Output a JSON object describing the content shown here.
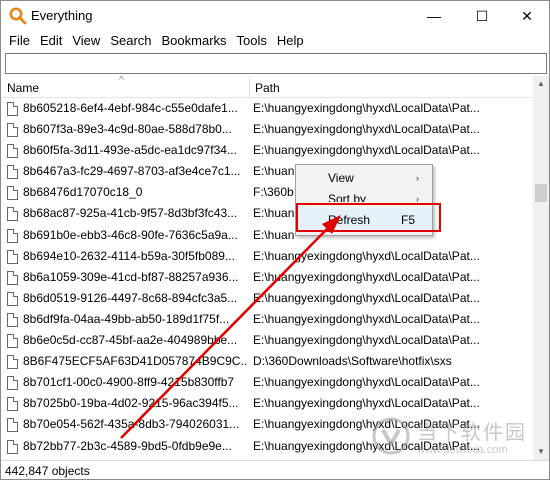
{
  "window": {
    "title": "Everything",
    "minimize_glyph": "—",
    "maximize_glyph": "☐",
    "close_glyph": "✕"
  },
  "menubar": {
    "items": [
      "File",
      "Edit",
      "View",
      "Search",
      "Bookmarks",
      "Tools",
      "Help"
    ]
  },
  "search": {
    "value": "",
    "placeholder": ""
  },
  "columns": {
    "name": "Name",
    "path": "Path",
    "sort_glyph": "^"
  },
  "rows": [
    {
      "name": "8b605218-6ef4-4ebf-984c-c55e0dafe1...",
      "path": "E:\\huangyexingdong\\hyxd\\LocalData\\Pat..."
    },
    {
      "name": "8b607f3a-89e3-4c9d-80ae-588d78b0...",
      "path": "E:\\huangyexingdong\\hyxd\\LocalData\\Pat..."
    },
    {
      "name": "8b60f5fa-3d11-493e-a5dc-ea1dc97f34...",
      "path": "E:\\huangyexingdong\\hyxd\\LocalData\\Pat..."
    },
    {
      "name": "8b6467a3-fc29-4697-8703-af3e4ce7c1...",
      "path": "E:\\huan"
    },
    {
      "name": "8b68476d17070c18_0",
      "path": "F:\\360b"
    },
    {
      "name": "8b68ac87-925a-41cb-9f57-8d3bf3fc43...",
      "path": "E:\\huan"
    },
    {
      "name": "8b691b0e-ebb3-46c8-90fe-7636c5a9a...",
      "path": "E:\\huan"
    },
    {
      "name": "8b694e10-2632-4114-b59a-30f5fb089...",
      "path": "E:\\huangyexingdong\\hyxd\\LocalData\\Pat..."
    },
    {
      "name": "8b6a1059-309e-41cd-bf87-88257a936...",
      "path": "E:\\huangyexingdong\\hyxd\\LocalData\\Pat..."
    },
    {
      "name": "8b6d0519-9126-4497-8c68-894cfc3a5...",
      "path": "E:\\huangyexingdong\\hyxd\\LocalData\\Pat..."
    },
    {
      "name": "8b6df9fa-04aa-49bb-ab50-189d1f75f...",
      "path": "E:\\huangyexingdong\\hyxd\\LocalData\\Pat..."
    },
    {
      "name": "8b6e0c5d-cc87-45bf-aa2e-404989bbe...",
      "path": "E:\\huangyexingdong\\hyxd\\LocalData\\Pat..."
    },
    {
      "name": "8B6F475ECF5AF63D41D057874B9C9C...",
      "path": "D:\\360Downloads\\Software\\hotfix\\sxs"
    },
    {
      "name": "8b701cf1-00c0-4900-8ff9-4215b830ffb7",
      "path": "E:\\huangyexingdong\\hyxd\\LocalData\\Pat..."
    },
    {
      "name": "8b7025b0-19ba-4d02-9215-96ac394f5...",
      "path": "E:\\huangyexingdong\\hyxd\\LocalData\\Pat..."
    },
    {
      "name": "8b70e054-562f-435a-8db3-794026031...",
      "path": "E:\\huangyexingdong\\hyxd\\LocalData\\Pat..."
    },
    {
      "name": "8b72bb77-2b3c-4589-9bd5-0fdb9e9e...",
      "path": "E:\\huangyexingdong\\hyxd\\LocalData\\Pat..."
    }
  ],
  "context_menu": {
    "view": "View",
    "sort_by": "Sort by",
    "refresh": "Refresh",
    "refresh_shortcut": "F5",
    "submenu_glyph": "›"
  },
  "statusbar": {
    "text": "442,847 objects"
  },
  "watermark": {
    "cn": "当下软件园",
    "url": "www.downxia.com"
  },
  "colors": {
    "annotation": "#e00000",
    "menu_highlight": "#e5f1fb",
    "app_icon": "#e8871e"
  },
  "icons": {
    "app": "everything-magnifier-icon",
    "file": "file-icon"
  }
}
